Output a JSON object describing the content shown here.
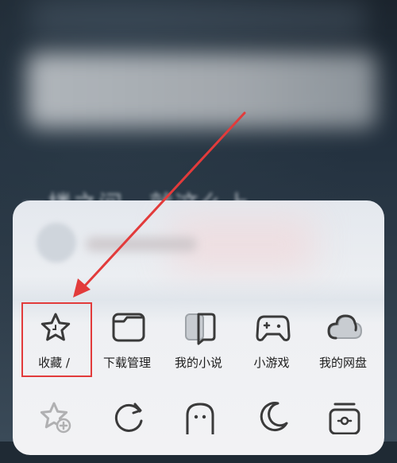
{
  "background": {
    "blurred_text": "一楼之间，就这么上"
  },
  "menu": {
    "row1": [
      {
        "label": "收藏 /",
        "icon": "star-icon"
      },
      {
        "label": "下载管理",
        "icon": "folder-icon"
      },
      {
        "label": "我的小说",
        "icon": "book-icon"
      },
      {
        "label": "小游戏",
        "icon": "gamepad-icon"
      },
      {
        "label": "我的网盘",
        "icon": "cloud-icon"
      }
    ],
    "row2": [
      {
        "icon": "add-bookmark-icon"
      },
      {
        "icon": "refresh-icon"
      },
      {
        "icon": "ghost-icon"
      },
      {
        "icon": "moon-icon"
      },
      {
        "icon": "toolbox-icon"
      }
    ]
  },
  "annotation": {
    "arrow_color": "#e23b3b",
    "highlight_color": "#e23b3b"
  }
}
